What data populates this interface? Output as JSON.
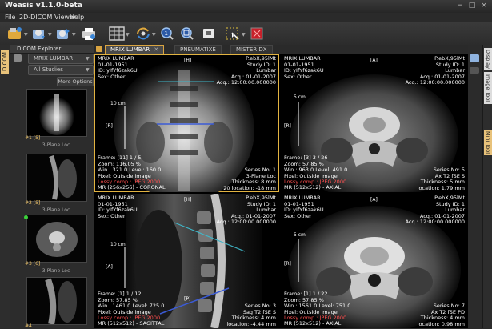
{
  "window": {
    "title": "Weasis v1.1.0-beta",
    "controls": [
      "−",
      "□",
      "×"
    ]
  },
  "menu": [
    "File",
    "2D-DICOM Viewer",
    "Help"
  ],
  "left_tab": "DICOM",
  "explorer": {
    "title": "DICOM Explorer",
    "patient": "MRIX LUMBAR",
    "studies": "All Studies",
    "more_options": "More Options",
    "thumbnails": [
      {
        "num": "#1 [5]",
        "caption": "3-Plane Loc"
      },
      {
        "num": "#2 [5]",
        "caption": "3-Plane Loc"
      },
      {
        "num": "#3 [6]",
        "caption": "3-Plane Loc"
      },
      {
        "num": "#4",
        "caption": ""
      }
    ]
  },
  "image_tabs": [
    "MRIX LUMBAR",
    "PNEUMATIXE",
    "MISTER DX"
  ],
  "right_tabs": [
    "Display",
    "Image Tool",
    "Mini Tool"
  ],
  "viewports": [
    {
      "tl": "MRIX LUMBAR\n01-01-1951\nID: yIfYf6zak6U\nSex: Other",
      "tr": "P.ebX,95lMt\nStudy ID: 1\nLumbar\nAcq.: 01-01-2007\nAcq.: 12:00:00.000000",
      "top_marker": "[H]",
      "left_marker": "[R]",
      "bottom_marker": "",
      "scale": "10 cm",
      "bl": "Frame: [11] 1 / 5\nZoom: 116.05 %\nWin.: 321.0 Level: 160.0\nPixel: Outside image",
      "bl_red": "Lossy comp.: JPEG 2000",
      "bl_tail": "MR (256x256) - CORONAL",
      "br": "Series No: 1\n3-Plane Loc\nThickness: 8 mm\n20 location: -18 mm"
    },
    {
      "tl": "MRIX LUMBAR\n01-01-1951\nID: yIfYf6zak6U\nSex: Other",
      "tr": "P.ebX,95lMt\nStudy ID: 1\nLumbar\nAcq.: 01-01-2007\nAcq.: 12:00:00.000000",
      "top_marker": "[A]",
      "left_marker": "[R]",
      "bottom_marker": "",
      "scale": "5 cm",
      "bl": "Frame: [3] 3 / 26\nZoom: 57.85 %\nWin.: 963.0 Level: 491.0\nPixel: Outside image",
      "bl_red": "Lossy comp.: JPEG 2000",
      "bl_tail": "MR (512x512) - AXIAL",
      "br": "Series No: 5\nAx T2 fSE S\nThickness: 5 mm\nlocation: 1.79 mm"
    },
    {
      "tl": "MRIX LUMBAR\n01-01-1951\nID: yIfYf6zak6U\nSex: Other",
      "tr": "P.ebX,95lMt\nStudy ID: 1\nLumbar\nAcq.: 01-01-2007\nAcq.: 12:00:00.000000",
      "top_marker": "[H]",
      "left_marker": "[A]",
      "bottom_marker": "[P]",
      "scale": "10 cm",
      "bl": "Frame: [1] 1 / 12\nZoom: 57.85 %\nWin.: 1461.0 Level: 725.0\nPixel: Outside image",
      "bl_red": "Lossy comp.: JPEG 2000",
      "bl_tail": "MR (512x512) - SAGITTAL",
      "br": "Series No: 3\nSag T2 fSE S\nThickness: 4 mm\nlocation: -4.44 mm"
    },
    {
      "tl": "MRIX LUMBAR\n01-01-1951\nID: yIfYf6zak6U\nSex: Other",
      "tr": "P.ebX,95lMt\nStudy ID: 1\nLumbar\nAcq.: 01-01-2007\nAcq.: 12:00:00.000000",
      "top_marker": "[A]",
      "left_marker": "[R]",
      "bottom_marker": "",
      "scale": "5 cm",
      "bl": "Frame: [1] 1 / 22\nZoom: 57.85 %\nWin.: 1561.0 Level: 751.0\nPixel: Outside image",
      "bl_red": "Lossy comp.: JPEG 2000",
      "bl_tail": "MR (512x512) - AXIAL",
      "br": "Series No: 7\nAx T2 fSE PD\nThickness: 4 mm\nlocation: 0.98 mm"
    }
  ],
  "colors": {
    "selection": "#e2b341",
    "accent_tab": "#e8c27a",
    "line_cyan": "#3fb6c8",
    "line_blue": "#3b5bd6",
    "lossy_red": "#ff5050"
  },
  "toolbar_icons": [
    "open-dicom-icon",
    "import-icon",
    "export-icon",
    "print-icon",
    "layout-grid-icon",
    "sync-icon",
    "zoom-icon",
    "zoom-fit-icon",
    "screenshot-icon",
    "measure-icon",
    "close-record-icon"
  ]
}
